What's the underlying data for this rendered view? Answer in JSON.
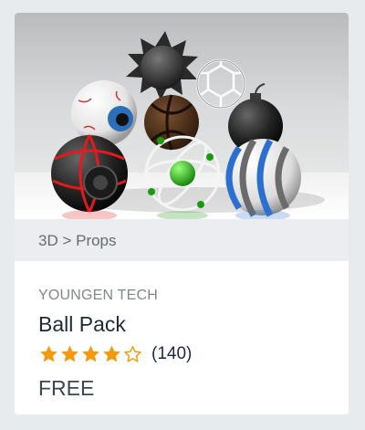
{
  "product": {
    "category": "3D > Props",
    "publisher": "YOUNGEN TECH",
    "title": "Ball Pack",
    "rating": 4,
    "rating_max": 5,
    "rating_count": "(140)",
    "price": "FREE"
  },
  "colors": {
    "star_color": "#f59a0c",
    "card_bg": "#ffffff",
    "category_bg": "#ebedf0",
    "page_bg": "#e8ebee"
  },
  "icons": [
    "star-filled-icon",
    "star-outline-icon"
  ]
}
